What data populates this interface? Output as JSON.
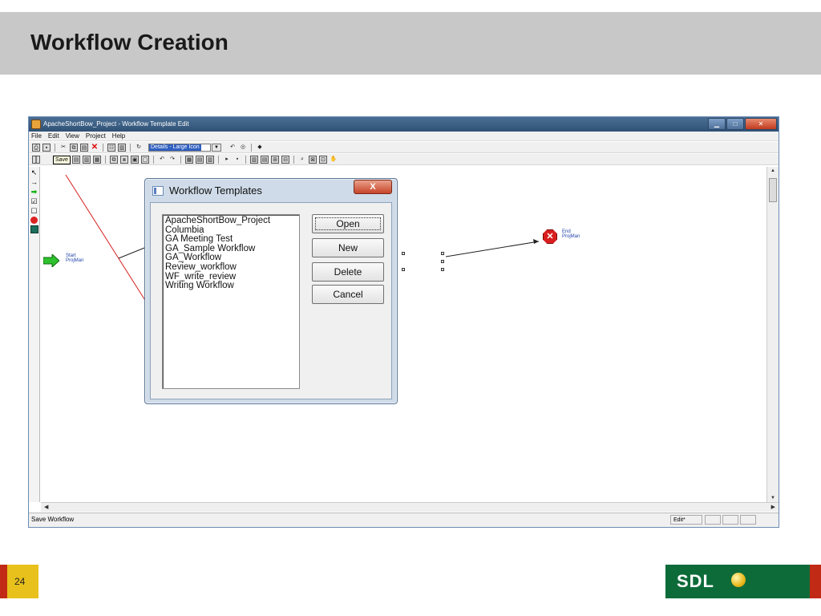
{
  "slide": {
    "title": "Workflow Creation",
    "page_number": "24",
    "logo_text": "SDL"
  },
  "window": {
    "title": "ApacheShortBow_Project - Workflow Template Edit",
    "controls": [
      "minimize",
      "maximize",
      "close"
    ]
  },
  "menubar": {
    "items": [
      "File",
      "Edit",
      "View",
      "Project",
      "Help"
    ]
  },
  "toolbar": {
    "view_select": "Details - Large Icon",
    "save_tooltip": "Save"
  },
  "canvas": {
    "start_label": "Start\nProjMan",
    "end_label": "End\nProjMan"
  },
  "statusbar": {
    "text": "Save Workflow",
    "mode": "Edit*"
  },
  "dialog": {
    "title": "Workflow Templates",
    "close_label": "X",
    "templates": [
      "ApacheShortBow_Project",
      "Columbia",
      "GA Meeting Test",
      "GA_Sample Workflow",
      "GA_Workflow",
      "Review_workflow",
      "WF_write_review",
      "Writing Workflow"
    ],
    "buttons": {
      "open": "Open",
      "new": "New",
      "delete": "Delete",
      "cancel": "Cancel"
    }
  },
  "colors": {
    "title_band": "#c8c8c8",
    "logo_green": "#0d6b3a",
    "accent_red": "#c12a14",
    "accent_yellow": "#e8c11c"
  }
}
